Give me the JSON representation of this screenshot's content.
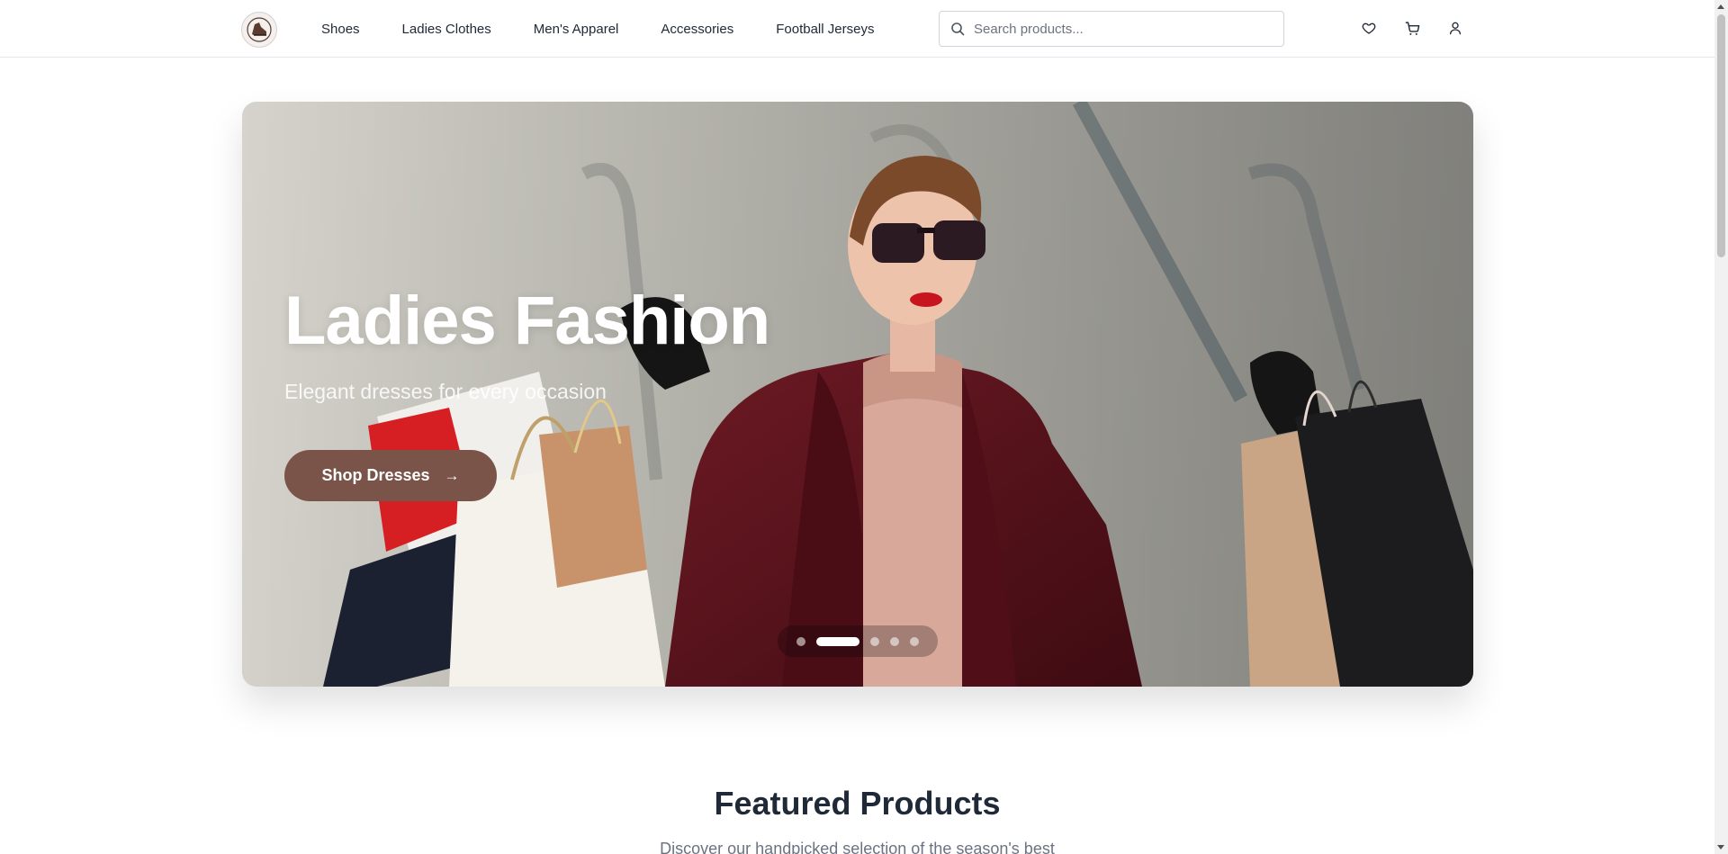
{
  "header": {
    "logo_icon": "brand-logo",
    "nav": [
      {
        "label": "Shoes"
      },
      {
        "label": "Ladies Clothes"
      },
      {
        "label": "Men's Apparel"
      },
      {
        "label": "Accessories"
      },
      {
        "label": "Football Jerseys"
      }
    ],
    "search": {
      "placeholder": "Search products...",
      "value": "",
      "icon": "search-icon"
    },
    "icons": [
      "heart-icon",
      "cart-icon",
      "user-icon"
    ]
  },
  "hero": {
    "title": "Ladies Fashion",
    "subtitle": "Elegant dresses for every occasion",
    "cta_label": "Shop Dresses",
    "cta_icon": "arrow-right-icon",
    "slides_total": 5,
    "active_slide": 2
  },
  "featured": {
    "title": "Featured Products",
    "subtitle": "Discover our handpicked selection of the season's best"
  },
  "colors": {
    "accent": "#7a5448",
    "text": "#1f2937",
    "muted": "#6b7280",
    "border": "#e5e7eb"
  }
}
